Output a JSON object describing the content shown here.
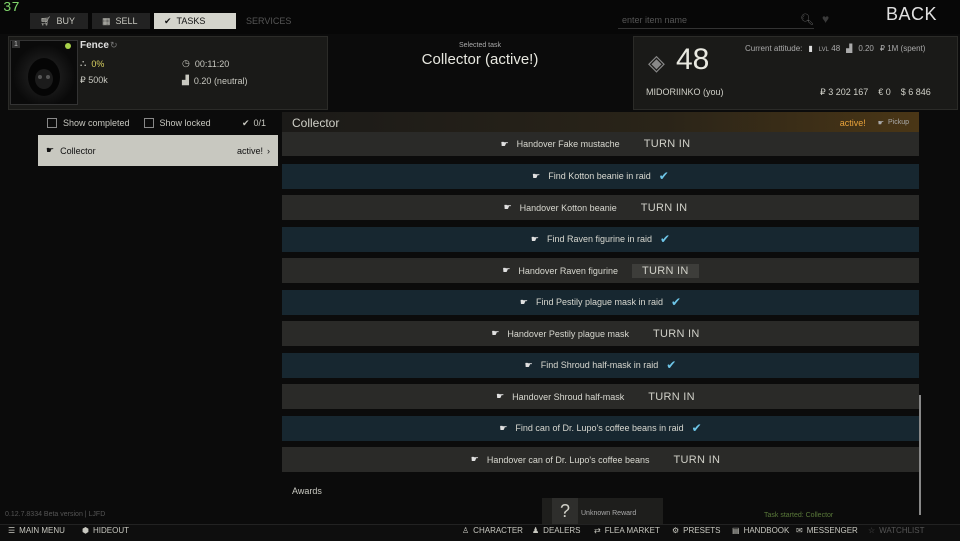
{
  "fps": "37",
  "top_tabs": [
    {
      "label": "BUY",
      "icon": "cart-icon"
    },
    {
      "label": "SELL",
      "icon": "money-icon"
    },
    {
      "label": "TASKS",
      "icon": "check-circle-icon"
    },
    {
      "label": "SERVICES",
      "icon": ""
    }
  ],
  "search": {
    "placeholder": "enter item name"
  },
  "back_label": "BACK",
  "trader": {
    "name": "Fence",
    "standing_level": "1",
    "loyalty_percent": "0%",
    "timer": "00:11:20",
    "money": "₽ 500k",
    "reputation": "0.20 (neutral)"
  },
  "selected_task": {
    "label": "Selected task",
    "title": "Collector (active!)"
  },
  "player": {
    "level": "48",
    "name": "MIDORIINKO (you)",
    "attitude_label": "Current attitude:",
    "attitude_lvl_prefix": "LVL",
    "attitude_lvl": "48",
    "attitude_rep": "0.20",
    "attitude_spent": "₽ 1M (spent)",
    "roubles": "₽ 3 202 167",
    "euros": "€ 0",
    "dollars": "$ 6 846"
  },
  "filters": {
    "show_completed": "Show completed",
    "show_locked": "Show locked",
    "count": "0/1"
  },
  "task_list": [
    {
      "name": "Collector",
      "status": "active!"
    }
  ],
  "task_header": {
    "title": "Collector",
    "status": "active!",
    "pickup": "Pickup"
  },
  "objectives": [
    {
      "type": "handover",
      "text": "Handover Fake mustache",
      "action": "TURN IN"
    },
    {
      "type": "find",
      "text": "Find Kotton beanie in raid",
      "action": ""
    },
    {
      "type": "handover",
      "text": "Handover Kotton beanie",
      "action": "TURN IN"
    },
    {
      "type": "find",
      "text": "Find Raven figurine in raid",
      "action": ""
    },
    {
      "type": "handover",
      "text": "Handover Raven figurine",
      "action": "TURN IN"
    },
    {
      "type": "find",
      "text": "Find Pestily plague mask in raid",
      "action": ""
    },
    {
      "type": "handover",
      "text": "Handover Pestily plague mask",
      "action": "TURN IN"
    },
    {
      "type": "find",
      "text": "Find Shroud half-mask in raid",
      "action": ""
    },
    {
      "type": "handover",
      "text": "Handover Shroud half-mask",
      "action": "TURN IN"
    },
    {
      "type": "find",
      "text": "Find can of Dr. Lupo's coffee beans in raid",
      "action": ""
    },
    {
      "type": "handover",
      "text": "Handover can of Dr. Lupo's coffee beans",
      "action": "TURN IN"
    }
  ],
  "awards": {
    "label": "Awards",
    "unknown_icon": "?",
    "unknown_text": "Unknown Reward"
  },
  "version": "0.12.7.8334 Beta version | LJFD",
  "notification": "Task started: Collector",
  "bottom_bar": {
    "main_menu": "MAIN MENU",
    "hideout": "HIDEOUT",
    "character": "CHARACTER",
    "dealers": "DEALERS",
    "flea_market": "FLEA MARKET",
    "presets": "PRESETS",
    "handbook": "HANDBOOK",
    "messenger": "MESSENGER",
    "watchlist": "WATCHLIST"
  }
}
